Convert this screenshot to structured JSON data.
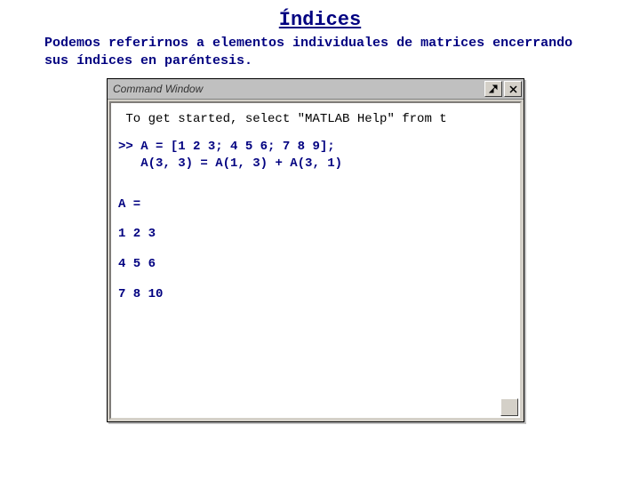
{
  "title": "Índices",
  "description": "Podemos referirnos a elementos individuales de matrices encerrando sus índices en paréntesis.",
  "window": {
    "title": "Command Window",
    "hint": " To get started, select \"MATLAB Help\" from t",
    "prompt": ">>",
    "input_lines": [
      "A = [1 2 3; 4 5 6; 7 8 9];",
      "A(3, 3) = A(1, 3) + A(3, 1)"
    ],
    "output": {
      "var": "A =",
      "rows": [
        "1 2 3",
        "4 5 6",
        "7 8 10"
      ]
    }
  }
}
